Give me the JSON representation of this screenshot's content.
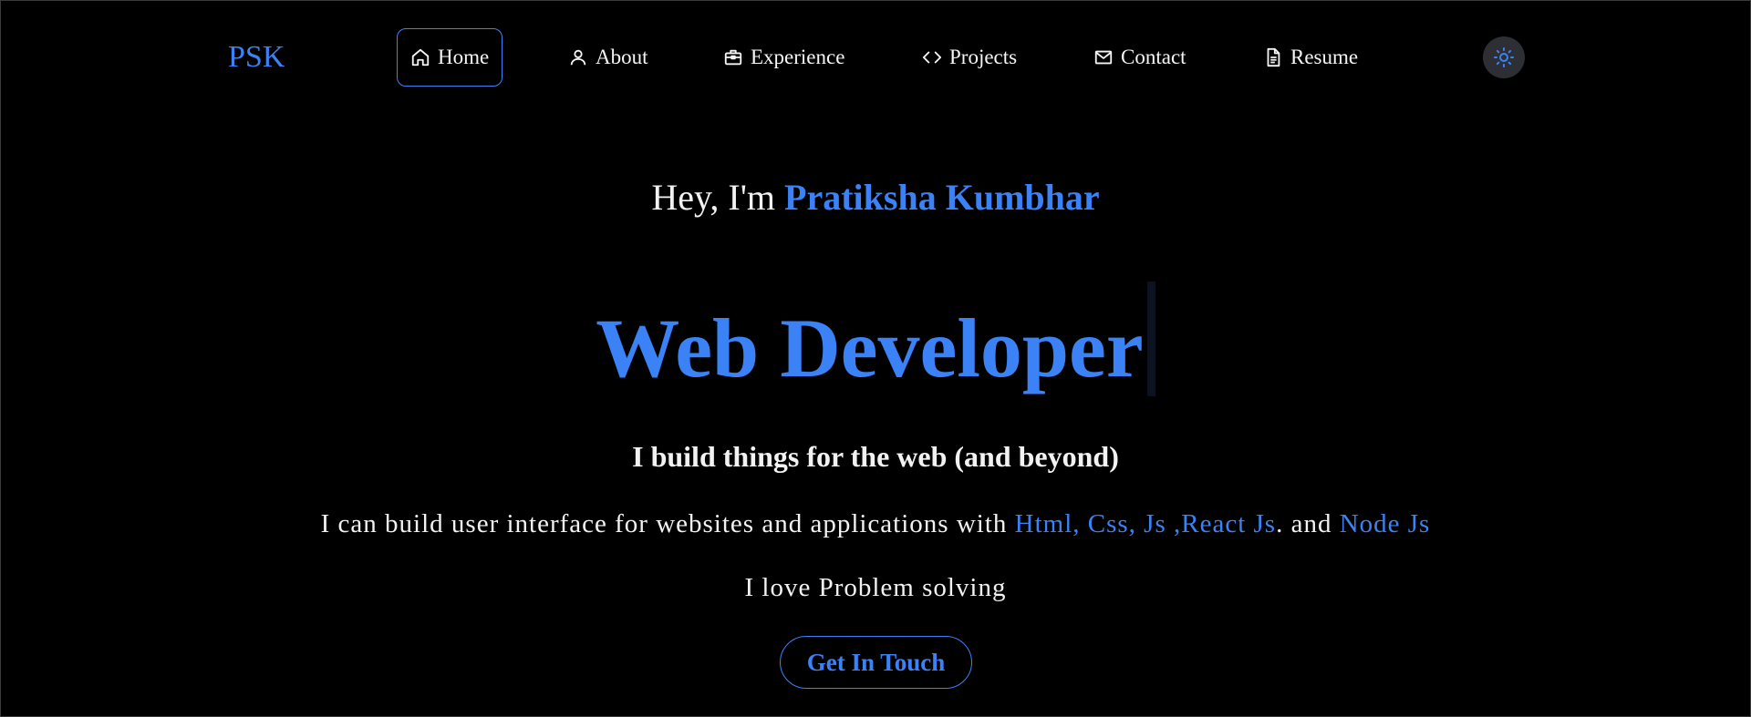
{
  "logo": "PSK",
  "nav": {
    "items": [
      {
        "label": "Home",
        "icon": "home-icon",
        "active": true
      },
      {
        "label": "About",
        "icon": "user-icon"
      },
      {
        "label": "Experience",
        "icon": "briefcase-icon"
      },
      {
        "label": "Projects",
        "icon": "code-icon"
      },
      {
        "label": "Contact",
        "icon": "mail-icon"
      },
      {
        "label": "Resume",
        "icon": "document-icon"
      }
    ],
    "theme_toggle_icon": "sun-icon"
  },
  "hero": {
    "greeting_prefix": "Hey, I'm ",
    "name": "Pratiksha Kumbhar",
    "role": "Web Developer",
    "tagline": "I build things for the web (and beyond)",
    "skills_prefix": "I can build user interface for websites and applications with ",
    "skills_highlight": "Html, Css, Js ,React Js",
    "skills_middle": ". and ",
    "skills_highlight_2": "Node Js",
    "love": "I love Problem solving",
    "cta": "Get In Touch"
  },
  "colors": {
    "accent": "#3b82f6",
    "background": "#000000",
    "text": "#f2f2f2",
    "toggle_bg": "#2d2f35"
  }
}
